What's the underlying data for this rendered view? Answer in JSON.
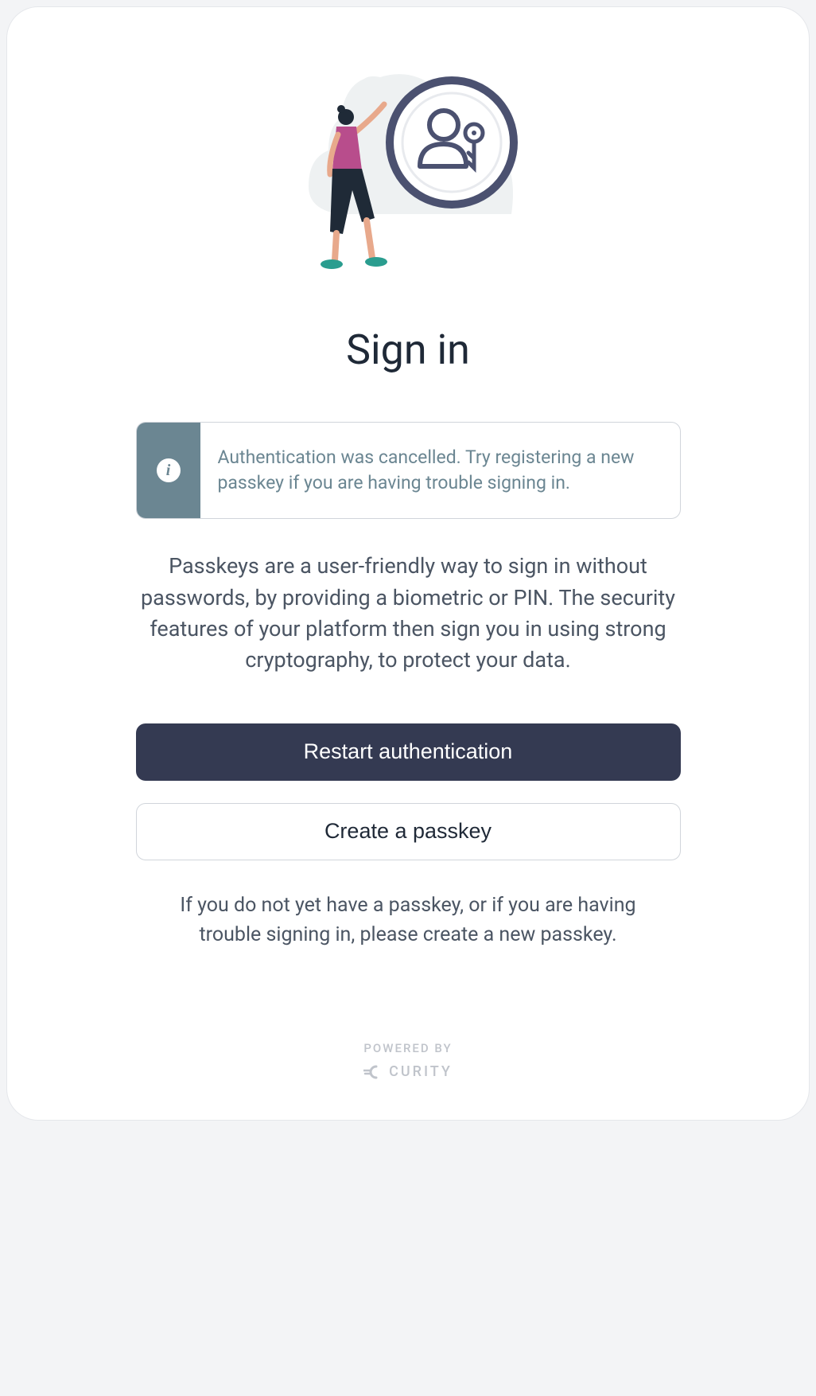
{
  "header": {
    "title": "Sign in"
  },
  "alert": {
    "message": "Authentication was cancelled. Try registering a new passkey if you are having trouble signing in."
  },
  "description": "Passkeys are a user-friendly way to sign in without passwords, by providing a biometric or PIN. The security features of your platform then sign you in using strong cryptography, to protect your data.",
  "buttons": {
    "primary": "Restart authentication",
    "secondary": "Create a passkey"
  },
  "helper": "If you do not yet have a passkey, or if you are having trouble signing in, please create a new passkey.",
  "footer": {
    "powered_label": "POWERED BY",
    "brand": "CURITY"
  },
  "colors": {
    "primary_btn_bg": "#343a52",
    "alert_accent": "#6b8692",
    "text_muted": "#4b5563"
  }
}
